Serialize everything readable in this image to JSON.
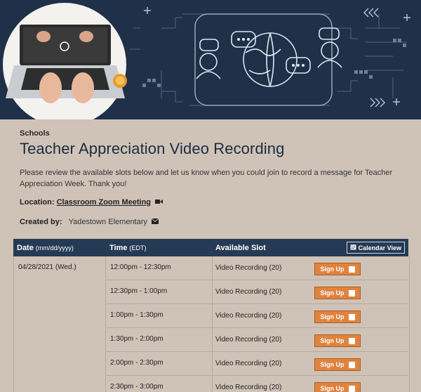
{
  "header": {
    "category": "Schools",
    "title": "Teacher Appreciation Video Recording",
    "description": "Please review the available slots below and let us know when you could join to record a message for Teacher Appreciation Week. Thank you!"
  },
  "location": {
    "label": "Location:",
    "value": "Classroom Zoom Meeting"
  },
  "created_by": {
    "label": "Created by:",
    "value": "Yadestown Elementary"
  },
  "table": {
    "col_date": "Date",
    "col_date_hint": "(mm/dd/yyyy)",
    "col_time": "Time",
    "col_time_hint": "(EDT)",
    "col_slot": "Available Slot",
    "calendar_view": "Calendar View",
    "date": "04/28/2021 (Wed.)",
    "rows": [
      {
        "time": "12:00pm - 12:30pm",
        "slot": "Video Recording (20)",
        "action": "Sign Up"
      },
      {
        "time": "12:30pm - 1:00pm",
        "slot": "Video Recording (20)",
        "action": "Sign Up"
      },
      {
        "time": "1:00pm - 1:30pm",
        "slot": "Video Recording (20)",
        "action": "Sign Up"
      },
      {
        "time": "1:30pm - 2:00pm",
        "slot": "Video Recording (20)",
        "action": "Sign Up"
      },
      {
        "time": "2:00pm - 2:30pm",
        "slot": "Video Recording (20)",
        "action": "Sign Up"
      },
      {
        "time": "2:30pm - 3:00pm",
        "slot": "Video Recording (20)",
        "action": "Sign Up"
      }
    ]
  },
  "colors": {
    "header_bg": "#253a54",
    "signup_bg": "#e0833f",
    "page_bg": "#cfc3b7",
    "title": "#1d2b3f"
  },
  "icons": {
    "location": "video-camera-icon",
    "creator": "envelope-icon",
    "calendar": "calendar-icon",
    "signup": "checkbox-icon"
  }
}
